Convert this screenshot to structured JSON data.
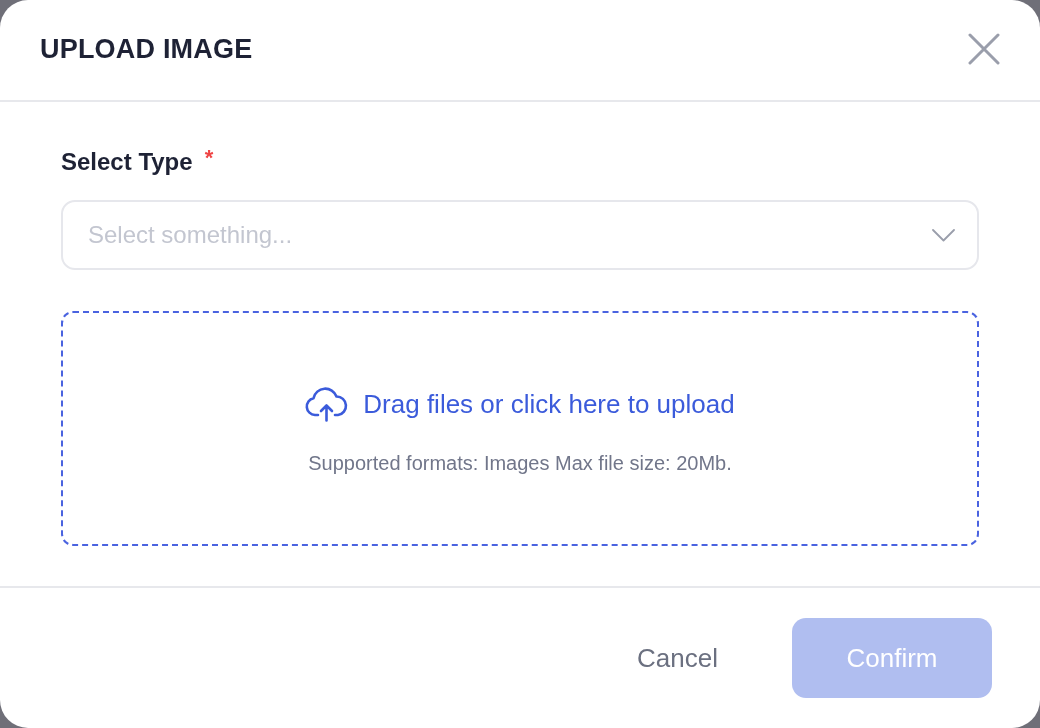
{
  "dialog": {
    "title": "UPLOAD IMAGE"
  },
  "select_type": {
    "label": "Select Type",
    "required_mark": "*",
    "placeholder": "Select something..."
  },
  "dropzone": {
    "prompt": "Drag files or click here to upload",
    "hint": "Supported formats: Images Max file size: 20Mb."
  },
  "buttons": [
    {
      "label": "Cancel",
      "kind": "text",
      "disabled": false
    },
    {
      "label": "Confirm",
      "kind": "primary",
      "disabled": true
    }
  ]
}
